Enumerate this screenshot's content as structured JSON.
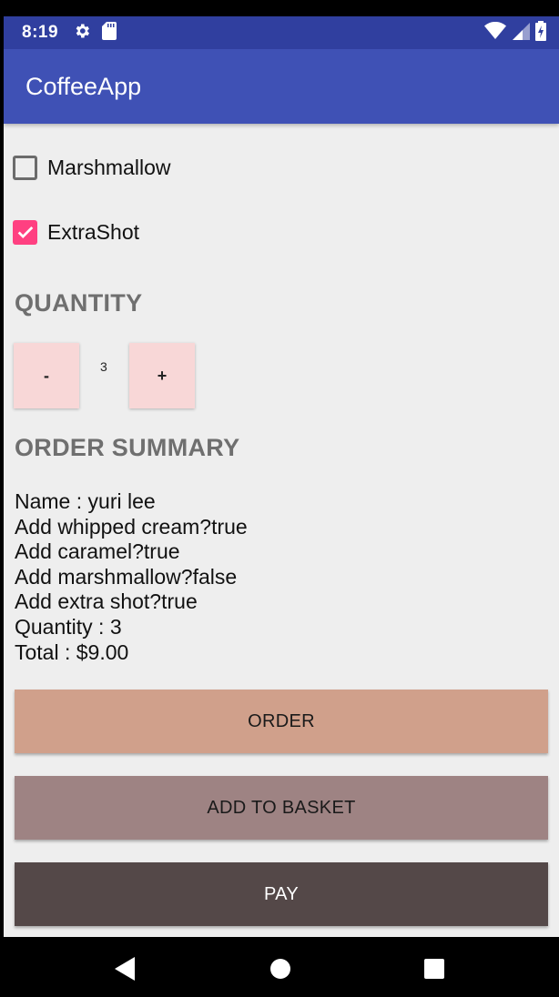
{
  "status_bar": {
    "time": "8:19",
    "left_icons": [
      "gear-icon",
      "sd-card-icon"
    ],
    "right_icons": [
      "wifi-icon",
      "signal-icon",
      "battery-icon"
    ]
  },
  "app_bar": {
    "title": "CoffeeApp",
    "color": "#3f51b5",
    "status_color": "#303f9f"
  },
  "toppings": [
    {
      "label": "Marshmallow",
      "checked": false
    },
    {
      "label": "ExtraShot",
      "checked": true
    }
  ],
  "quantity": {
    "title": "QUANTITY",
    "decrement_label": "-",
    "value": "3",
    "increment_label": "+"
  },
  "order_summary": {
    "title": "ORDER SUMMARY",
    "lines": [
      "Name : yuri lee",
      "Add whipped cream?true",
      "Add caramel?true",
      "Add marshmallow?false",
      "Add extra shot?true",
      "Quantity : 3",
      "Total : $9.00"
    ]
  },
  "actions": {
    "order_label": "ORDER",
    "order_color": "#d0a08b",
    "basket_label": "ADD TO BASKET",
    "basket_color": "#9e8383",
    "pay_label": "PAY",
    "pay_color": "#544848"
  },
  "nav_bar": {
    "icons": [
      "back-icon",
      "home-icon",
      "recents-icon"
    ]
  },
  "accent_color": "#ff4081"
}
